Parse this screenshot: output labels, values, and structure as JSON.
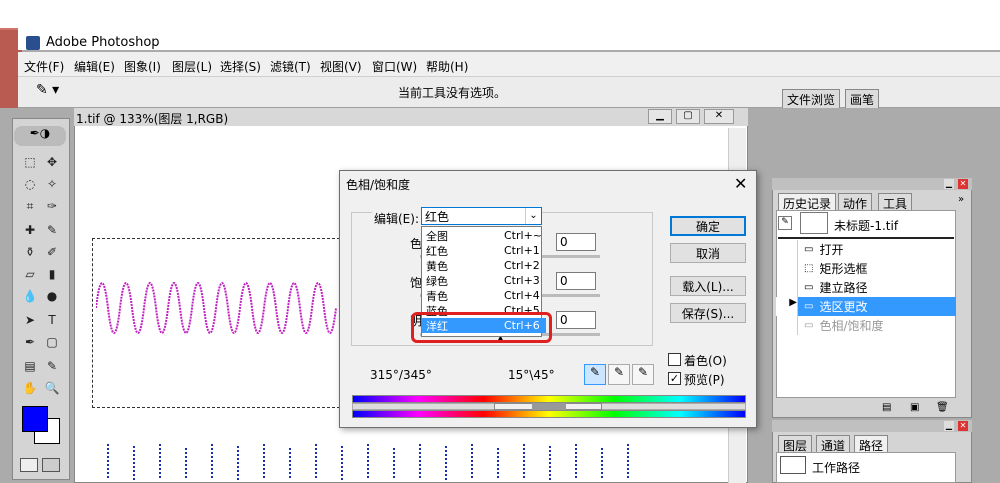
{
  "app": {
    "title": "Adobe Photoshop",
    "menu": [
      "文件(F)",
      "编辑(E)",
      "图象(I)",
      "图层(L)",
      "选择(S)",
      "滤镜(T)",
      "视图(V)",
      "窗口(W)",
      "帮助(H)"
    ],
    "options_hint": "当前工具没有选项。",
    "palette_tabs": [
      "文件浏览",
      "画笔"
    ]
  },
  "document": {
    "title": "1.tif @ 133%(图层 1,RGB)"
  },
  "dialog": {
    "title": "色相/饱和度",
    "edit_label": "编辑(E):",
    "edit_value": "红色",
    "dropdown": [
      {
        "label": "全图",
        "shortcut": "Ctrl+~"
      },
      {
        "label": "红色",
        "shortcut": "Ctrl+1"
      },
      {
        "label": "黄色",
        "shortcut": "Ctrl+2"
      },
      {
        "label": "绿色",
        "shortcut": "Ctrl+3"
      },
      {
        "label": "青色",
        "shortcut": "Ctrl+4"
      },
      {
        "label": "蓝色",
        "shortcut": "Ctrl+5"
      },
      {
        "label": "洋红",
        "shortcut": "Ctrl+6"
      }
    ],
    "selected_index": 6,
    "row_labels": [
      "色",
      "饱",
      "明"
    ],
    "values": [
      "0",
      "0",
      "0"
    ],
    "buttons": {
      "ok": "确定",
      "cancel": "取消",
      "load": "载入(L)...",
      "save": "保存(S)..."
    },
    "colorize": "着色(O)",
    "preview": "预览(P)",
    "range_left": "315°/345°",
    "range_right": "15°\\45°"
  },
  "history": {
    "tabs": [
      "历史记录",
      "动作",
      "工具"
    ],
    "snapshot": "未标题-1.tif",
    "items": [
      "打开",
      "矩形选框",
      "建立路径",
      "选区更改",
      "色相/饱和度"
    ],
    "active_index": 3
  },
  "layers": {
    "tabs": [
      "图层",
      "通道",
      "路径"
    ],
    "path_item": "工作路径"
  },
  "colors": {
    "accent": "#3399ff",
    "foreground": "#0000ff",
    "highlight_red": "#e02020"
  }
}
